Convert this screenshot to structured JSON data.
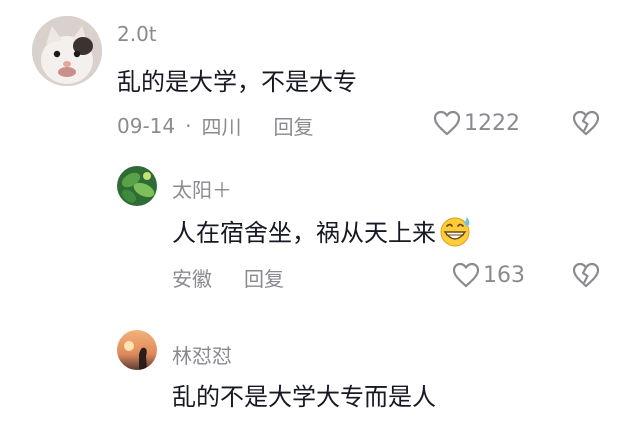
{
  "comments": [
    {
      "username": "2.0t",
      "text": "乱的是大学，不是大专",
      "date": "09-14",
      "separator": "·",
      "location": "四川",
      "reply_label": "回复",
      "likes": "1222"
    },
    {
      "username": "太阳＋",
      "text": "人在宿舍坐，祸从天上来",
      "location": "安徽",
      "reply_label": "回复",
      "likes": "163"
    },
    {
      "username": "林怼怼",
      "text": "乱的不是大学大专而是人"
    }
  ]
}
